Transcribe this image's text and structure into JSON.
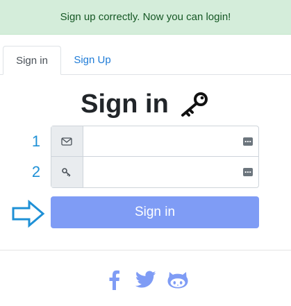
{
  "alert": {
    "message": "Sign up correctly. Now you can login!"
  },
  "tabs": [
    {
      "label": "Sign in",
      "active": true
    },
    {
      "label": "Sign Up",
      "active": false
    }
  ],
  "heading": {
    "title": "Sign in",
    "icon": "key-icon"
  },
  "annotations": {
    "field1": "1",
    "field2": "2",
    "pointer_icon": "arrow-right-outline-icon"
  },
  "form": {
    "email": {
      "icon": "envelope-icon",
      "value": "",
      "placeholder": ""
    },
    "password": {
      "icon": "key-icon",
      "value": "",
      "placeholder": ""
    },
    "submit_label": "Sign in"
  },
  "social": {
    "icons": [
      "facebook-icon",
      "twitter-icon",
      "github-icon"
    ],
    "color": "#7f9cf5"
  },
  "colors": {
    "alert_bg": "#d4edda",
    "alert_text": "#155724",
    "primary_button": "#7f9cf5",
    "link": "#1e7bd7",
    "annotation": "#1e90d6"
  }
}
